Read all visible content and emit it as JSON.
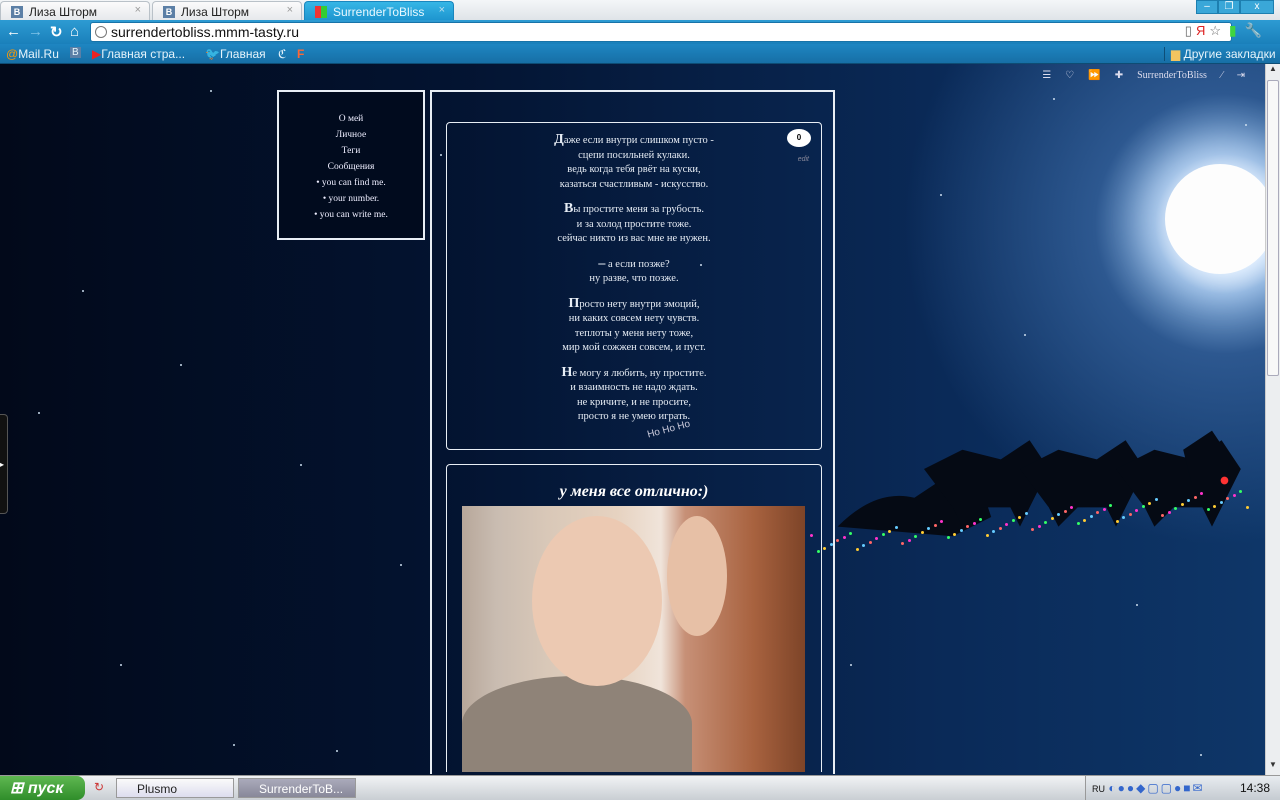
{
  "browser": {
    "tabs": [
      {
        "label": "Лиза Шторм",
        "icon": "vk-icon"
      },
      {
        "label": "Лиза Шторм",
        "icon": "vk-icon"
      },
      {
        "label": "SurrenderToBliss",
        "icon": "tumblr-icon",
        "active": true
      }
    ],
    "url": "surrendertobliss.mmm-tasty.ru",
    "bookmarks": [
      "Mail.Ru",
      "Главная стра...",
      "Главная"
    ],
    "other_bookmarks": "Другие закладки"
  },
  "topbar": {
    "username": "SurrenderToBliss"
  },
  "sidebar": {
    "items": [
      "О мей",
      "Личное",
      "Теги",
      "Сообщения",
      "• you can find me.",
      "• your number.",
      "• you can write me."
    ]
  },
  "post1": {
    "comments": "0",
    "edit": "edit",
    "stamp": "Ho Ho Ho",
    "stanzas": [
      [
        "Даже если внутри слишком пусто -",
        "сцепи посильней кулаки.",
        "ведь когда тебя рвёт на куски,",
        "казаться счастливым - искусство."
      ],
      [
        "Вы простите меня за грубость.",
        "и за холод простите тоже.",
        "сейчас никто из вас мне не нужен."
      ],
      [
        "– а если позже?",
        "ну разве, что позже."
      ],
      [
        "Просто нету внутри эмоций,",
        "ни каких совсем нету чувств.",
        "теплоты у меня нету тоже,",
        "мир мой сожжен совсем, и пуст."
      ],
      [
        "Не могу я любить, ну простите.",
        "и взаимность не надо ждать.",
        "не кричите, и не просите,",
        "просто я не умею играть."
      ]
    ]
  },
  "post2": {
    "title": "у меня все отлично:)"
  },
  "taskbar": {
    "start": "пуск",
    "tasks": [
      "Plusmo",
      "SurrenderToB..."
    ],
    "lang": "RU",
    "clock": "14:38"
  }
}
